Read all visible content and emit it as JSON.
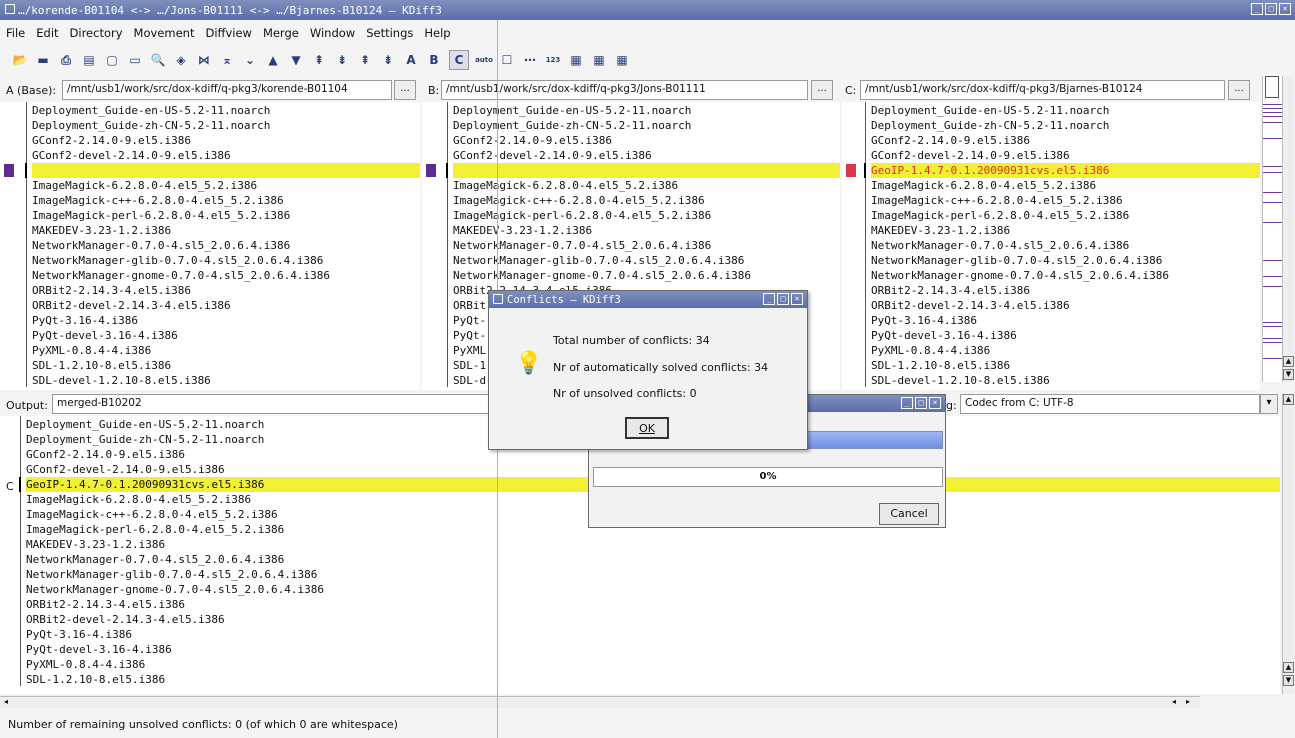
{
  "window": {
    "title": "…/korende-B01104 <-> …/Jons-B01111 <-> …/Bjarnes-B10124 – KDiff3"
  },
  "menu": [
    "File",
    "Edit",
    "Directory",
    "Movement",
    "Diffview",
    "Merge",
    "Window",
    "Settings",
    "Help"
  ],
  "toolbar": {
    "icons": [
      "open-icon",
      "save-icon",
      "print-icon",
      "save-as-icon",
      "copy-icon",
      "paste-icon",
      "find-icon",
      "go-current-icon",
      "go-top-icon",
      "go-bottom-icon",
      "go-prev-delta-icon",
      "go-next-delta-icon",
      "go-prev-conflict-icon",
      "go-next-conflict-icon",
      "go-prev-unsolved-icon",
      "go-next-unsolved-icon",
      "select-a-icon",
      "select-b-icon",
      "select-c-icon",
      "auto-advance-icon",
      "show-whitespace-icon",
      "show-linenumbers-icon",
      "split-icon",
      "overview-icon"
    ],
    "glyphs": [
      "📂",
      "▬",
      "⎙",
      "▤",
      "▢",
      "▭",
      "🔍",
      "◈",
      "⋈",
      "⌅",
      "⌄",
      "▲",
      "▼",
      "⇞",
      "⇟",
      "⇞",
      "⇟",
      "A",
      "B",
      "C",
      "auto",
      "☐",
      "⋯",
      "123",
      "▦",
      "▦",
      "▦"
    ],
    "active_index": 19
  },
  "paths": {
    "a_label": "A (Base):",
    "a_path": "/mnt/usb1/work/src/dox-kdiff/q-pkg3/korende-B01104",
    "b_label": "B:",
    "b_path": "/mnt/usb1/work/src/dox-kdiff/q-pkg3/Jons-B01111",
    "c_label": "C:",
    "c_path": "/mnt/usb1/work/src/dox-kdiff/q-pkg3/Bjarnes-B10124",
    "browse": "..."
  },
  "pane_a": {
    "lines": [
      "Deployment_Guide-en-US-5.2-11.noarch",
      "Deployment_Guide-zh-CN-5.2-11.noarch",
      "GConf2-2.14.0-9.el5.i386",
      "GConf2-devel-2.14.0-9.el5.i386",
      "",
      "ImageMagick-6.2.8.0-4.el5_5.2.i386",
      "ImageMagick-c++-6.2.8.0-4.el5_5.2.i386",
      "ImageMagick-perl-6.2.8.0-4.el5_5.2.i386",
      "MAKEDEV-3.23-1.2.i386",
      "NetworkManager-0.7.0-4.sl5_2.0.6.4.i386",
      "NetworkManager-glib-0.7.0-4.sl5_2.0.6.4.i386",
      "NetworkManager-gnome-0.7.0-4.sl5_2.0.6.4.i386",
      "ORBit2-2.14.3-4.el5.i386",
      "ORBit2-devel-2.14.3-4.el5.i386",
      "PyQt-3.16-4.i386",
      "PyQt-devel-3.16-4.i386",
      "PyXML-0.8.4-4.i386",
      "SDL-1.2.10-8.el5.i386",
      "SDL-devel-1.2.10-8.el5.i386"
    ]
  },
  "pane_b": {
    "lines": [
      "Deployment_Guide-en-US-5.2-11.noarch",
      "Deployment_Guide-zh-CN-5.2-11.noarch",
      "GConf2-2.14.0-9.el5.i386",
      "GConf2-devel-2.14.0-9.el5.i386",
      "",
      "ImageMagick-6.2.8.0-4.el5_5.2.i386",
      "ImageMagick-c++-6.2.8.0-4.el5_5.2.i386",
      "ImageMagick-perl-6.2.8.0-4.el5_5.2.i386",
      "MAKEDEV-3.23-1.2.i386",
      "NetworkManager-0.7.0-4.sl5_2.0.6.4.i386",
      "NetworkManager-glib-0.7.0-4.sl5_2.0.6.4.i386",
      "NetworkManager-gnome-0.7.0-4.sl5_2.0.6.4.i386",
      "ORBit2-2.14.3-4.el5.i386",
      "ORBit",
      "PyQt-",
      "PyQt-",
      "PyXML",
      "SDL-1",
      "SDL-d"
    ]
  },
  "pane_c": {
    "lines": [
      "Deployment_Guide-en-US-5.2-11.noarch",
      "Deployment_Guide-zh-CN-5.2-11.noarch",
      "GConf2-2.14.0-9.el5.i386",
      "GConf2-devel-2.14.0-9.el5.i386",
      "GeoIP-1.4.7-0.1.20090931cvs.el5.i386",
      "ImageMagick-6.2.8.0-4.el5_5.2.i386",
      "ImageMagick-c++-6.2.8.0-4.el5_5.2.i386",
      "ImageMagick-perl-6.2.8.0-4.el5_5.2.i386",
      "MAKEDEV-3.23-1.2.i386",
      "NetworkManager-0.7.0-4.sl5_2.0.6.4.i386",
      "NetworkManager-glib-0.7.0-4.sl5_2.0.6.4.i386",
      "NetworkManager-gnome-0.7.0-4.sl5_2.0.6.4.i386",
      "ORBit2-2.14.3-4.el5.i386",
      "ORBit2-devel-2.14.3-4.el5.i386",
      "PyQt-3.16-4.i386",
      "PyQt-devel-3.16-4.i386",
      "PyXML-0.8.4-4.i386",
      "SDL-1.2.10-8.el5.i386",
      "SDL-devel-1.2.10-8.el5.i386"
    ]
  },
  "output": {
    "label": "Output:",
    "filename": "merged-B10202",
    "encoding_label": "g:",
    "encoding_value": "Codec from C: UTF-8",
    "source_marker": "C",
    "lines": [
      "Deployment_Guide-en-US-5.2-11.noarch",
      "Deployment_Guide-zh-CN-5.2-11.noarch",
      "GConf2-2.14.0-9.el5.i386",
      "GConf2-devel-2.14.0-9.el5.i386",
      "GeoIP-1.4.7-0.1.20090931cvs.el5.i386",
      "ImageMagick-6.2.8.0-4.el5_5.2.i386",
      "ImageMagick-c++-6.2.8.0-4.el5_5.2.i386",
      "ImageMagick-perl-6.2.8.0-4.el5_5.2.i386",
      "MAKEDEV-3.23-1.2.i386",
      "NetworkManager-0.7.0-4.sl5_2.0.6.4.i386",
      "NetworkManager-glib-0.7.0-4.sl5_2.0.6.4.i386",
      "NetworkManager-gnome-0.7.0-4.sl5_2.0.6.4.i386",
      "ORBit2-2.14.3-4.el5.i386",
      "ORBit2-devel-2.14.3-4.el5.i386",
      "PyQt-3.16-4.i386",
      "PyQt-devel-3.16-4.i386",
      "PyXML-0.8.4-4.i386",
      "SDL-1.2.10-8.el5.i386"
    ]
  },
  "conflicts_dialog": {
    "title": "Conflicts – KDiff3",
    "total": "Total number of conflicts: 34",
    "auto": "Nr of automatically solved conflicts: 34",
    "unsolved": "Nr of unsolved conflicts: 0",
    "ok": "OK"
  },
  "progress_dialog": {
    "percent_text": "0%",
    "progress": 0,
    "cancel": "Cancel"
  },
  "status": {
    "text": "Number of remaining unsolved conflicts: 0 (of which 0 are whitespace)"
  },
  "colors": {
    "highlight": "#f2f035",
    "marker_a": "#5b2d8e",
    "marker_b": "#5b2d8e",
    "marker_c": "#d9364a",
    "titlebar": "#6a7db4"
  }
}
